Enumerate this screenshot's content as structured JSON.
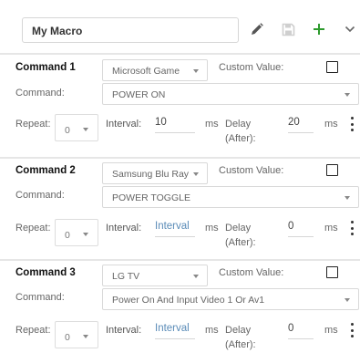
{
  "header": {
    "macro_name": "My Macro",
    "icons": [
      "pencil-icon",
      "save-icon",
      "plus-icon",
      "chevron-down-icon"
    ],
    "plus_color": "#2e9b2e"
  },
  "labels": {
    "custom_value": "Custom Value:",
    "command": "Command:",
    "repeat": "Repeat:",
    "interval": "Interval:",
    "ms": "ms",
    "delay": "Delay",
    "after": "(After):"
  },
  "commands": [
    {
      "title": "Command 1",
      "device": "Microsoft Game",
      "command": "POWER ON",
      "repeat": "0",
      "interval": "10",
      "interval_placeholder": false,
      "delay": "20"
    },
    {
      "title": "Command 2",
      "device": "Samsung Blu Ray",
      "command": "POWER TOGGLE",
      "repeat": "0",
      "interval": "Interval",
      "interval_placeholder": true,
      "delay": "0"
    },
    {
      "title": "Command 3",
      "device": "LG TV",
      "command": "Power On And Input Video 1 Or Av1",
      "repeat": "0",
      "interval": "Interval",
      "interval_placeholder": true,
      "delay": "0"
    }
  ]
}
